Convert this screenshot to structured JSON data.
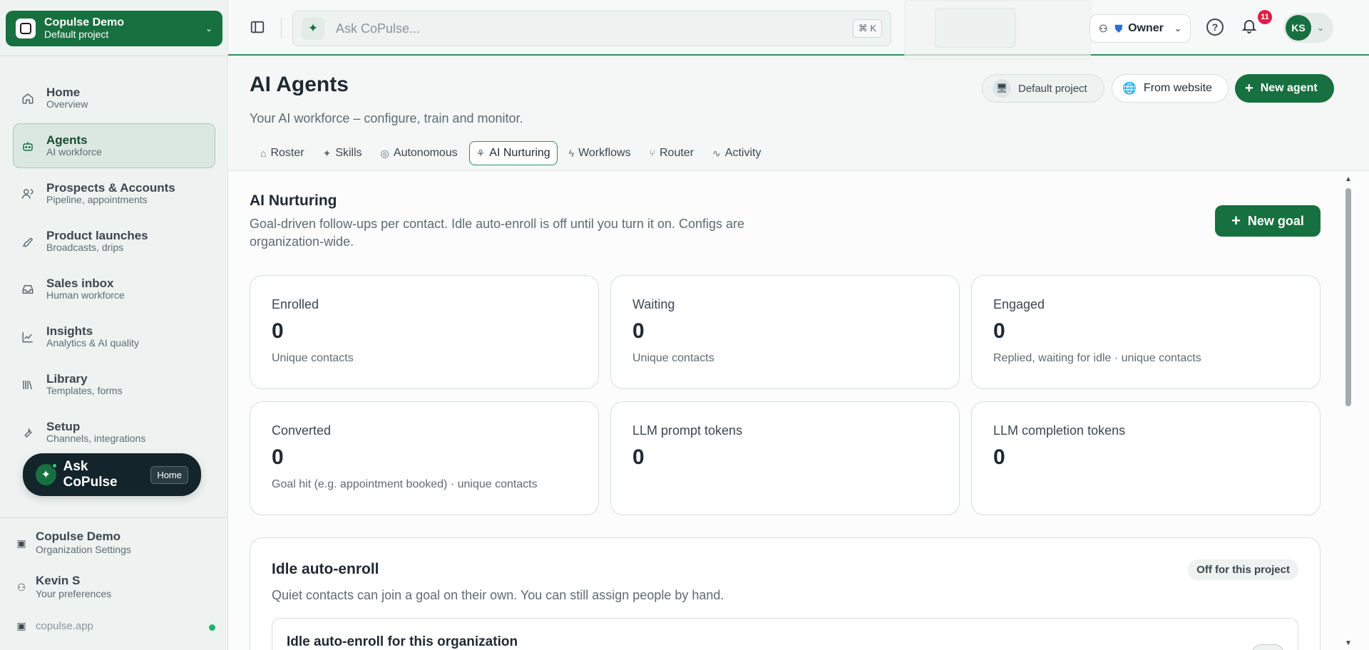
{
  "project": {
    "title": "Copulse Demo",
    "subtitle": "Default project"
  },
  "nav": [
    {
      "label": "Home",
      "sub": "Overview",
      "icon": "home-icon"
    },
    {
      "label": "Agents",
      "sub": "AI workforce",
      "icon": "robot-icon",
      "active": true
    },
    {
      "label": "Prospects & Accounts",
      "sub": "Pipeline, appointments",
      "icon": "users-icon"
    },
    {
      "label": "Product launches",
      "sub": "Broadcasts, drips",
      "icon": "rocket-icon"
    },
    {
      "label": "Sales inbox",
      "sub": "Human workforce",
      "icon": "inbox-icon"
    },
    {
      "label": "Insights",
      "sub": "Analytics & AI quality",
      "icon": "chart-icon"
    },
    {
      "label": "Library",
      "sub": "Templates, forms",
      "icon": "library-icon"
    },
    {
      "label": "Setup",
      "sub": "Channels, integrations",
      "icon": "wrench-icon"
    }
  ],
  "ask_pill": {
    "label": "Ask CoPulse",
    "tag": "Home"
  },
  "footer": {
    "org": {
      "label": "Copulse Demo",
      "sub": "Organization Settings"
    },
    "user": {
      "label": "Kevin S",
      "sub": "Your preferences"
    },
    "domain": "copulse.app"
  },
  "topbar": {
    "search_placeholder": "Ask CoPulse...",
    "shortcut": "⌘ K",
    "role": "Owner",
    "notification_count": "11",
    "avatar_initials": "KS"
  },
  "page": {
    "title": "AI Agents",
    "subtitle": "Your AI workforce – configure, train and monitor.",
    "btn_default_project": "Default project",
    "btn_from_website": "From website",
    "btn_new_agent": "New agent"
  },
  "tabs": [
    {
      "label": "Roster",
      "icon": "robot-icon"
    },
    {
      "label": "Skills",
      "icon": "sparkle-icon"
    },
    {
      "label": "Autonomous",
      "icon": "target-icon"
    },
    {
      "label": "AI Nurturing",
      "icon": "sprout-icon",
      "active": true
    },
    {
      "label": "Workflows",
      "icon": "bolt-icon"
    },
    {
      "label": "Router",
      "icon": "route-icon"
    },
    {
      "label": "Activity",
      "icon": "pulse-icon"
    }
  ],
  "section": {
    "title": "AI Nurturing",
    "description": "Goal-driven follow-ups per contact. Idle auto-enroll is off until you turn it on. Configs are organization-wide.",
    "new_goal": "New goal"
  },
  "stats": [
    {
      "label": "Enrolled",
      "value": "0",
      "sub": "Unique contacts"
    },
    {
      "label": "Waiting",
      "value": "0",
      "sub": "Unique contacts"
    },
    {
      "label": "Engaged",
      "value": "0",
      "sub": "Replied, waiting for idle · unique contacts"
    },
    {
      "label": "Converted",
      "value": "0",
      "sub": "Goal hit (e.g. appointment booked) · unique contacts"
    },
    {
      "label": "LLM prompt tokens",
      "value": "0",
      "sub": ""
    },
    {
      "label": "LLM completion tokens",
      "value": "0",
      "sub": ""
    }
  ],
  "idle": {
    "title": "Idle auto-enroll",
    "description": "Quiet contacts can join a goal on their own. You can still assign people by hand.",
    "badge": "Off for this project",
    "inner_title": "Idle auto-enroll for this organization"
  },
  "colors": {
    "brand": "#17703f",
    "badge": "#e11d48"
  }
}
